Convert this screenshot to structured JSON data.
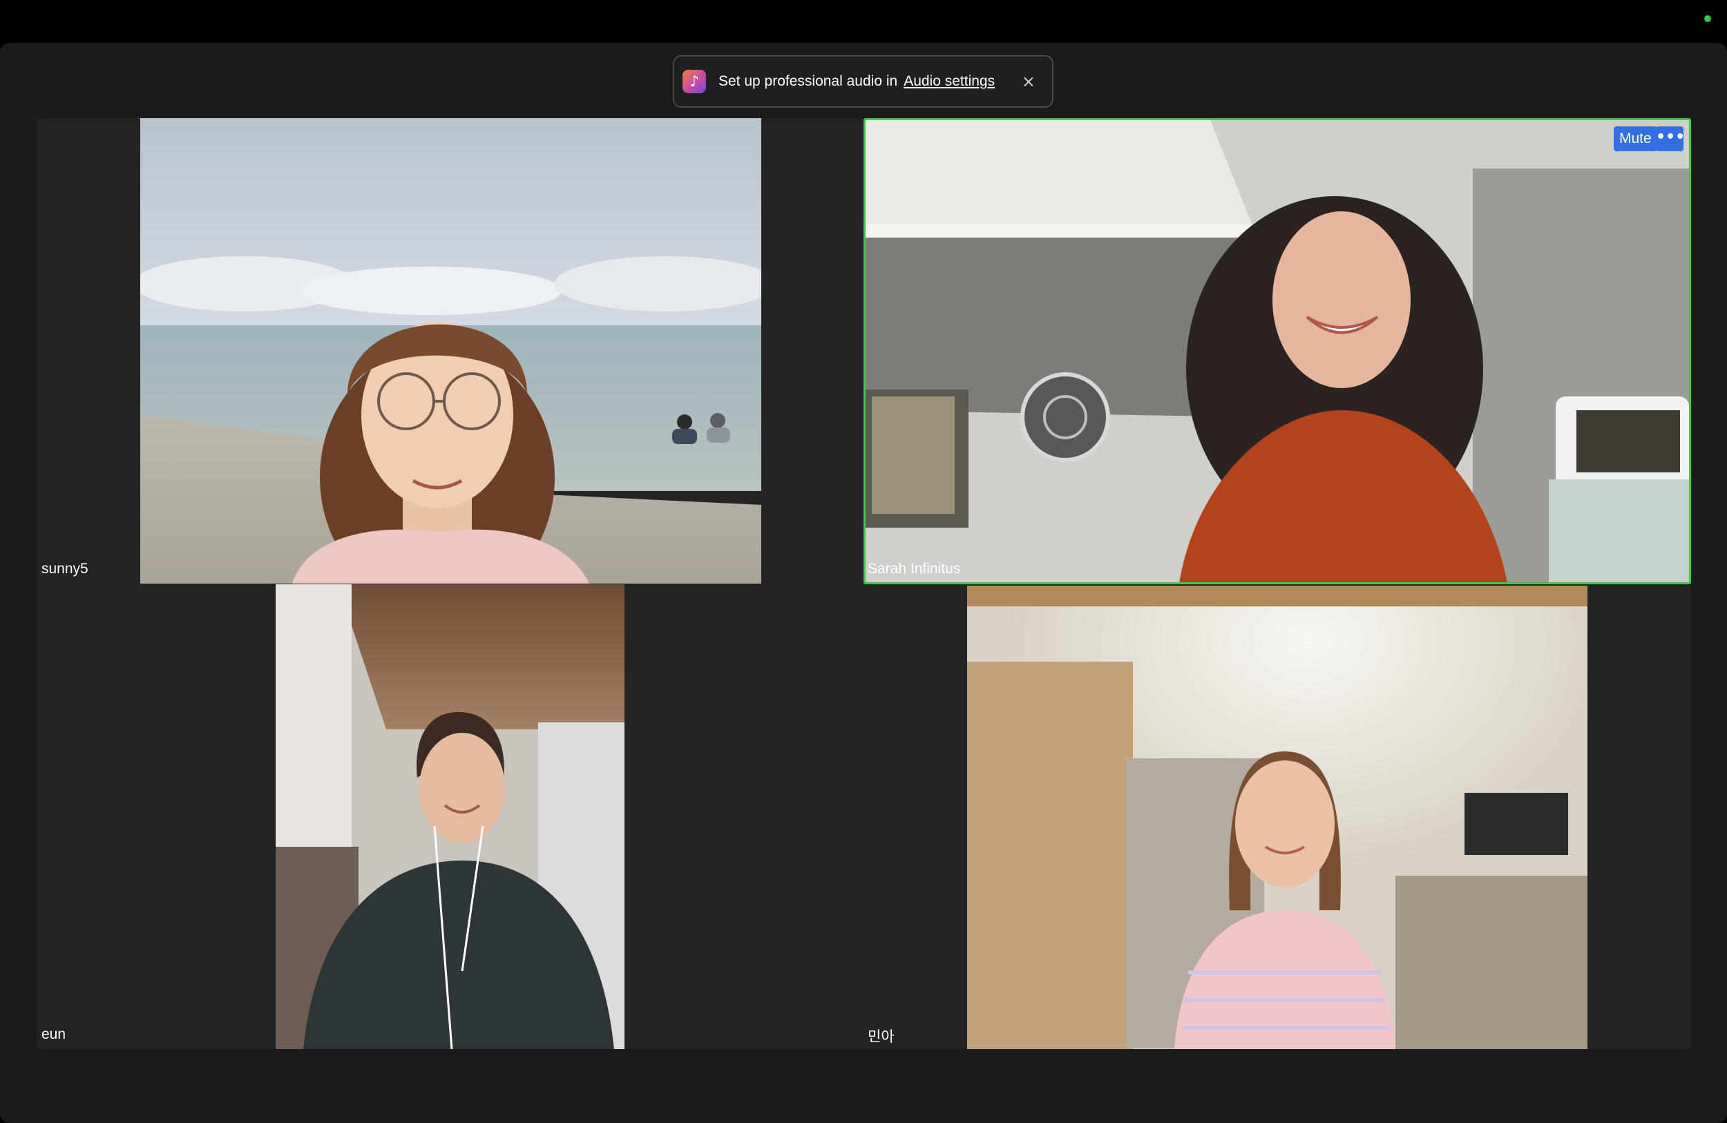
{
  "banner": {
    "message": "Set up professional audio in",
    "link": "Audio settings",
    "close": "×"
  },
  "participants": [
    {
      "name": "sunny5"
    },
    {
      "name": "Sarah Infinitus",
      "mute_label": "Mute",
      "more_label": "•••",
      "active_speaker": true
    },
    {
      "name": "eun"
    },
    {
      "name": "민아"
    }
  ],
  "colors": {
    "active_border": "#48c252",
    "button_blue": "#2f6fe0",
    "background": "#232323"
  }
}
